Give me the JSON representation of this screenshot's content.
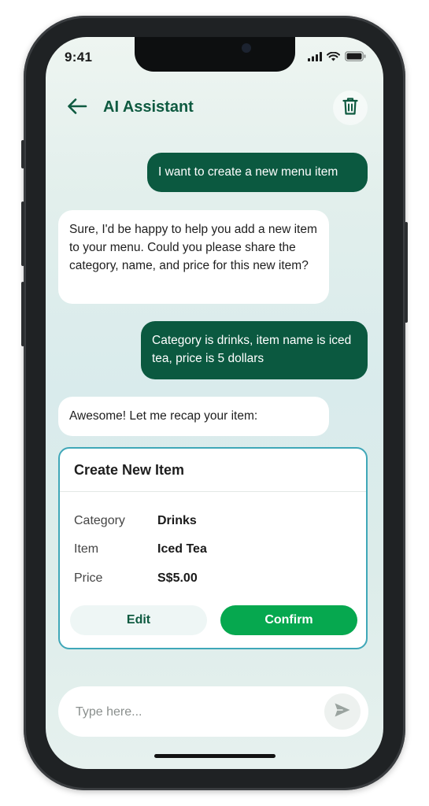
{
  "status_bar": {
    "time": "9:41"
  },
  "header": {
    "title": "AI Assistant",
    "back_icon": "arrow-left-icon",
    "trash_icon": "trash-icon"
  },
  "messages": [
    {
      "role": "user",
      "text": "I want to create a new menu item"
    },
    {
      "role": "assistant",
      "text": "Sure, I'd be happy to help you add a new item to your menu. Could you please share the category, name, and price for this new item?"
    },
    {
      "role": "user",
      "text": "Category is drinks, item name is iced tea, price is 5 dollars"
    },
    {
      "role": "assistant",
      "text": "Awesome! Let me recap your item:"
    }
  ],
  "card": {
    "title": "Create New Item",
    "rows": [
      {
        "label": "Category",
        "value": "Drinks"
      },
      {
        "label": "Item",
        "value": "Iced Tea"
      },
      {
        "label": "Price",
        "value": "S$5.00"
      }
    ],
    "edit_label": "Edit",
    "confirm_label": "Confirm"
  },
  "composer": {
    "placeholder": "Type here...",
    "value": "",
    "send_icon": "send-icon"
  },
  "colors": {
    "brand_dark_green": "#0b5940",
    "confirm_green": "#06a84f",
    "card_border": "#3fa7b8"
  }
}
